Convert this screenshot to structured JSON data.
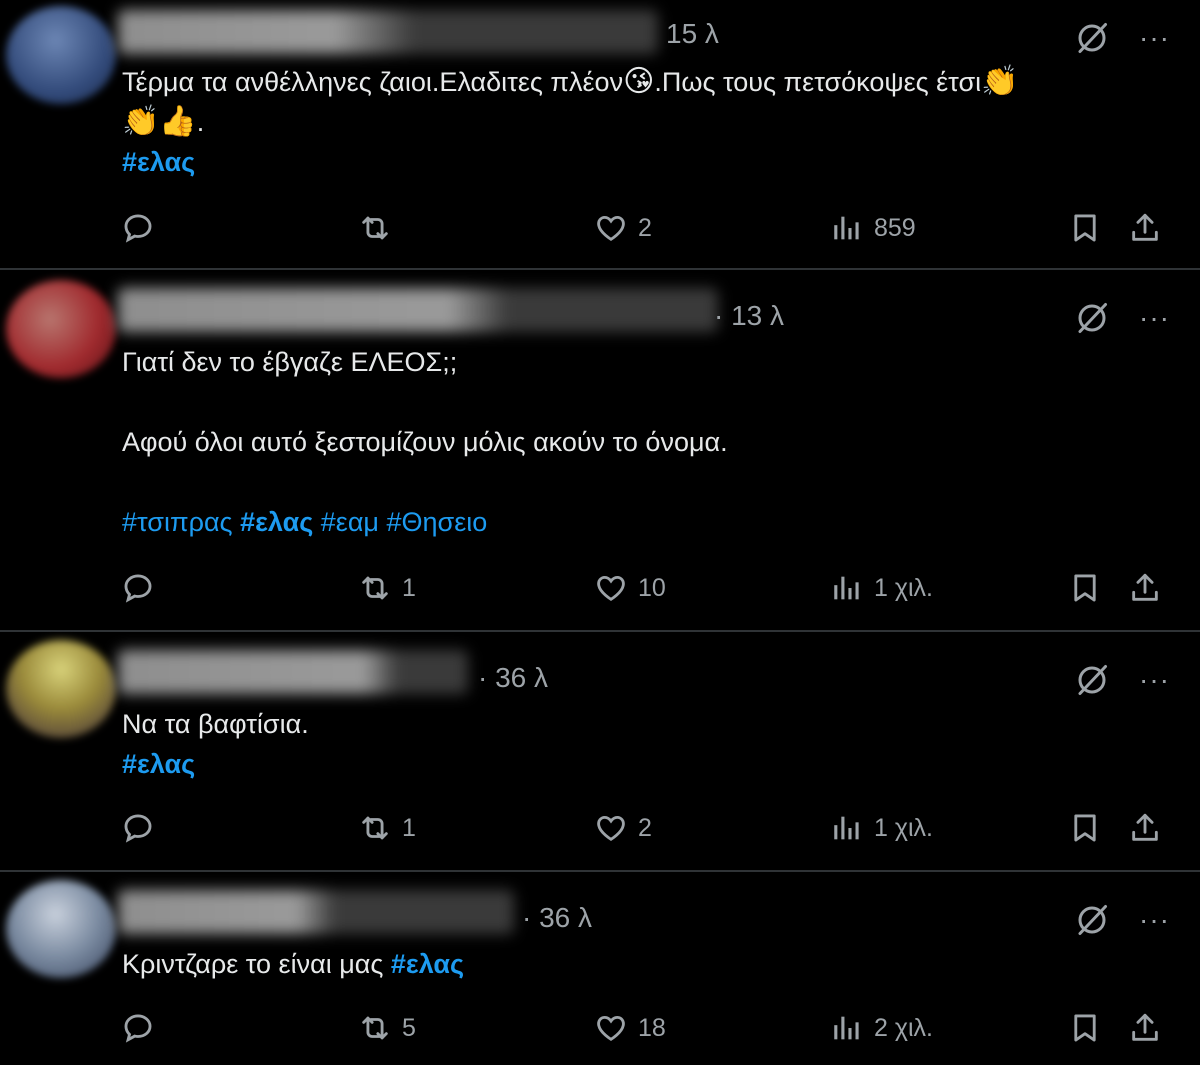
{
  "colors": {
    "background": "#000000",
    "text": "#e7e9ea",
    "muted": "#9da3a8",
    "hashtag": "#1d9bf0",
    "divider": "#2f3336"
  },
  "tweets": [
    {
      "time": "15 λ",
      "text_before": "Τέρμα τα ανθέλληνες ζαιοι.Ελαδιτες πλέον",
      "emoji1": "😘",
      "text_mid": ".Πως τους πετσόκοψες έτσι",
      "emoji2": "👏",
      "emoji3": "👏👍",
      "text_end": ".",
      "hashtag": "#ελας",
      "replies": "",
      "retweets": "",
      "likes": "2",
      "views": "859"
    },
    {
      "time": "· 13 λ",
      "line1": "Γιατί δεν το έβγαζε ΕΛΕΟΣ;;",
      "line2": "Αφού όλοι αυτό ξεστομίζουν μόλις ακούν το όνομα.",
      "tags": [
        "#τσιπρας",
        "#ελας",
        "#εαμ",
        "#Θησειο"
      ],
      "replies": "",
      "retweets": "1",
      "likes": "10",
      "views": "1 χιλ."
    },
    {
      "time": "· 36 λ",
      "text": "Να τα βαφτίσια.",
      "hashtag": "#ελας",
      "replies": "",
      "retweets": "1",
      "likes": "2",
      "views": "1 χιλ."
    },
    {
      "time": "· 36 λ",
      "text": "Κριντζαρε το είναι μας ",
      "hashtag": "#ελας",
      "replies": "",
      "retweets": "5",
      "likes": "18",
      "views": "2 χιλ."
    }
  ],
  "more_label": "···"
}
